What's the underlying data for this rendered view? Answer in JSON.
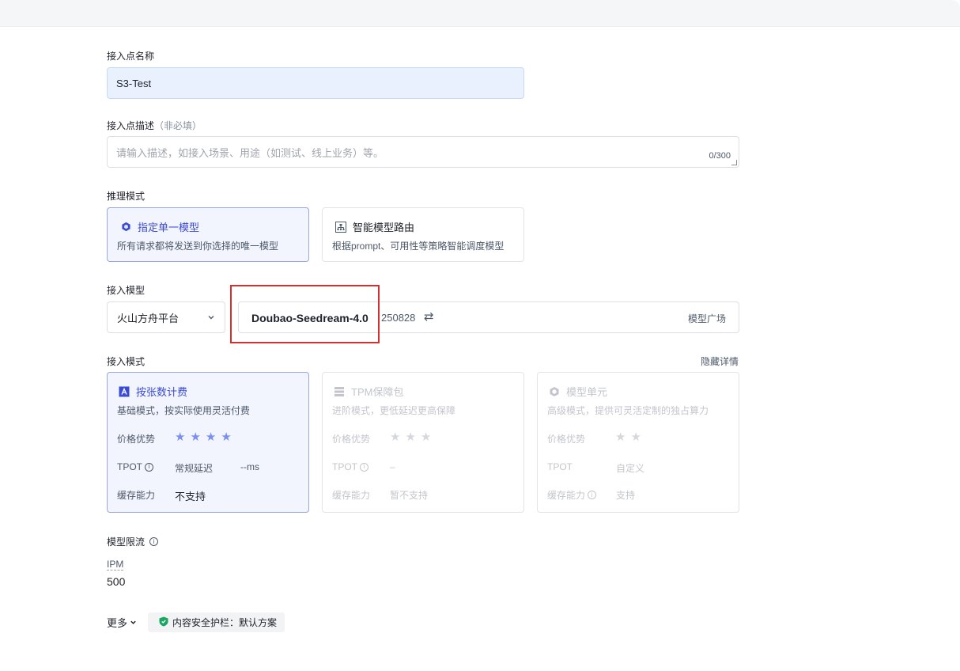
{
  "form": {
    "name_label": "接入点名称",
    "name_value": "S3-Test",
    "desc_label": "接入点描述",
    "desc_optional": "（非必填）",
    "desc_placeholder": "请输入描述，如接入场景、用途（如测试、线上业务）等。",
    "desc_counter": "0/300",
    "inference_label": "推理模式",
    "inference_modes": [
      {
        "title": "指定单一模型",
        "desc": "所有请求都将发送到你选择的唯一模型",
        "icon": "cube-icon",
        "selected": true
      },
      {
        "title": "智能模型路由",
        "desc": "根据prompt、可用性等策略智能调度模型",
        "icon": "router-icon",
        "selected": false
      }
    ],
    "model_label": "接入模型",
    "platform_value": "火山方舟平台",
    "model_name": "Doubao-Seedream-4.0",
    "model_version": "250828",
    "model_plaza": "模型广场",
    "access_label": "接入模式",
    "hide_details": "隐藏详情",
    "access_modes": [
      {
        "title": "按张数计费",
        "desc": "基础模式，按实际使用灵活付费",
        "icon": "image-billing-icon",
        "price_label": "价格优势",
        "stars": 4,
        "tpot_label": "TPOT",
        "tpot_value": "常规延迟",
        "tpot_ms": "--ms",
        "cache_label": "缓存能力",
        "cache_value": "不支持"
      },
      {
        "title": "TPM保障包",
        "desc": "进阶模式，更低延迟更高保障",
        "icon": "stack-icon",
        "price_label": "价格优势",
        "stars": 3,
        "tpot_label": "TPOT",
        "tpot_value": "–",
        "cache_label": "缓存能力",
        "cache_value": "暂不支持"
      },
      {
        "title": "模型单元",
        "desc": "高级模式，提供可灵活定制的独占算力",
        "icon": "unit-icon",
        "price_label": "价格优势",
        "stars": 2,
        "tpot_label": "TPOT",
        "tpot_value": "自定义",
        "cache_label": "缓存能力",
        "cache_value": "支持"
      }
    ],
    "rate_limit_label": "模型限流",
    "ipm_label": "IPM",
    "ipm_value": "500",
    "more_label": "更多",
    "safety_label": "内容安全护栏：默认方案"
  },
  "colors": {
    "accent": "#3a4bd1",
    "star_active": "#7b8ff0",
    "highlight": "#d32f2f",
    "safety_green": "#1aa561"
  }
}
